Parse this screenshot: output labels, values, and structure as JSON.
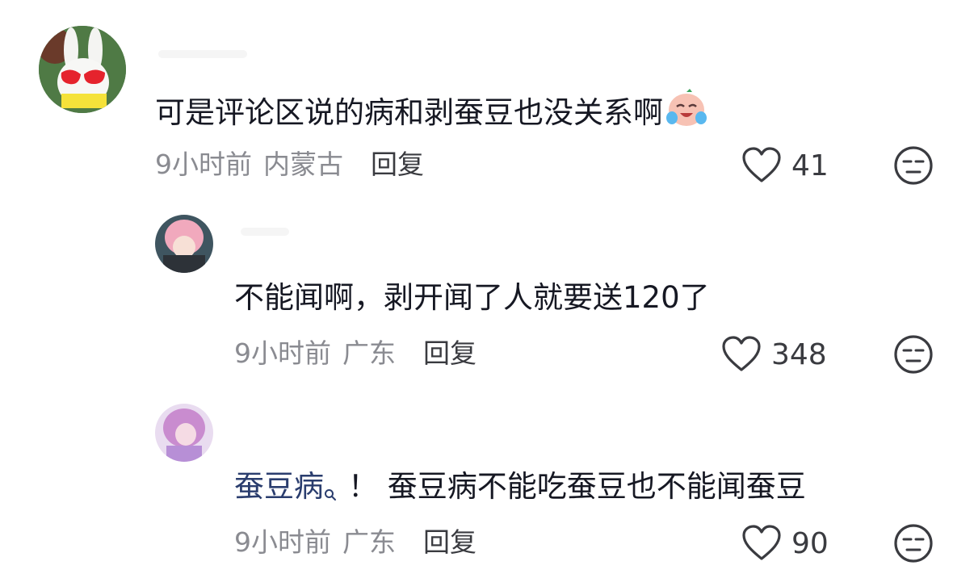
{
  "comments": [
    {
      "text": "可是评论区说的病和剥蚕豆也没关系啊",
      "emoji": "laughing-crying-emoji",
      "time": "9小时前",
      "location": "内蒙古",
      "reply_label": "回复",
      "likes": "41"
    },
    {
      "text": "不能闻啊，剥开闻了人就要送120了",
      "time": "9小时前",
      "location": "广东",
      "reply_label": "回复",
      "likes": "348"
    },
    {
      "link_text": "蚕豆病",
      "text": "！ 蚕豆病不能吃蚕豆也不能闻蚕豆",
      "time": "9小时前",
      "location": "广东",
      "reply_label": "回复",
      "likes": "90"
    }
  ],
  "icons": {
    "like": "heart-outline-icon",
    "dislike": "unamused-face-icon",
    "search": "search-icon"
  },
  "colors": {
    "text": "#161823",
    "meta": "#8a8b91",
    "link": "#2a3d6e",
    "icon": "#3a3b40"
  }
}
